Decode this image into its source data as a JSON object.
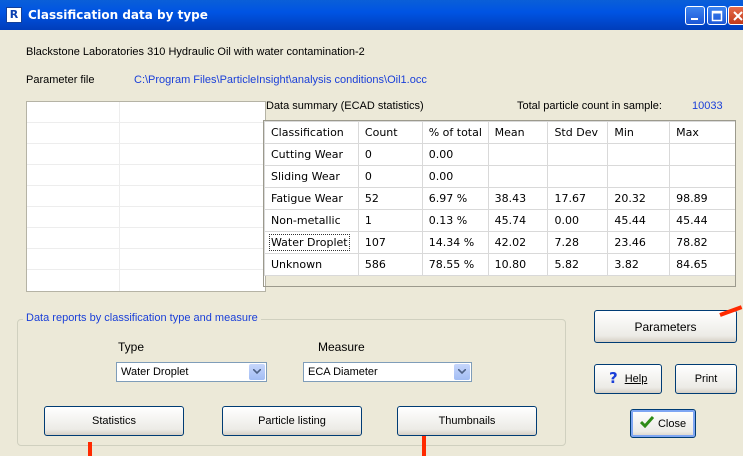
{
  "window": {
    "title": "Classification data by type",
    "icon_letter": "R"
  },
  "sample": {
    "description": "Blackstone Laboratories  310 Hydraulic Oil with water contamination-2"
  },
  "parameter_file": {
    "label": "Parameter file",
    "path": "C:\\Program Files\\ParticleInsight\\analysis conditions\\Oil1.occ"
  },
  "summary": {
    "title": "Data summary  (ECAD statistics)",
    "total_label": "Total particle count in sample:",
    "total_value": "10033"
  },
  "table": {
    "headers": [
      "Classification",
      "Count",
      "% of total",
      "Mean",
      "Std Dev",
      "Min",
      "Max"
    ],
    "rows": [
      [
        "Cutting Wear",
        "0",
        "0.00",
        "",
        "",
        "",
        ""
      ],
      [
        "Sliding Wear",
        "0",
        "0.00",
        "",
        "",
        "",
        ""
      ],
      [
        "Fatigue Wear",
        "52",
        "6.97 %",
        "38.43",
        "17.67",
        "20.32",
        "98.89"
      ],
      [
        "Non-metallic",
        "1",
        "0.13 %",
        "45.74",
        "0.00",
        "45.44",
        "45.44"
      ],
      [
        "Water Droplet",
        "107",
        "14.34 %",
        "42.02",
        "7.28",
        "23.46",
        "78.82"
      ],
      [
        "Unknown",
        "586",
        "78.55 %",
        "10.80",
        "5.82",
        "3.82",
        "84.65"
      ]
    ]
  },
  "reports": {
    "group_title": "Data reports by classification type and measure",
    "type_label": "Type",
    "type_value": "Water Droplet",
    "measure_label": "Measure",
    "measure_value": "ECA Diameter",
    "statistics_button": "Statistics",
    "particle_listing_button": "Particle listing",
    "thumbnails_button": "Thumbnails"
  },
  "actions": {
    "parameters_button": "Parameters",
    "help_button": "Help",
    "print_button": "Print",
    "close_button": "Close"
  },
  "colors": {
    "link_blue": "#1a3fd8",
    "annotation_red": "#ff2a00",
    "titlebar": "#0054e3"
  }
}
